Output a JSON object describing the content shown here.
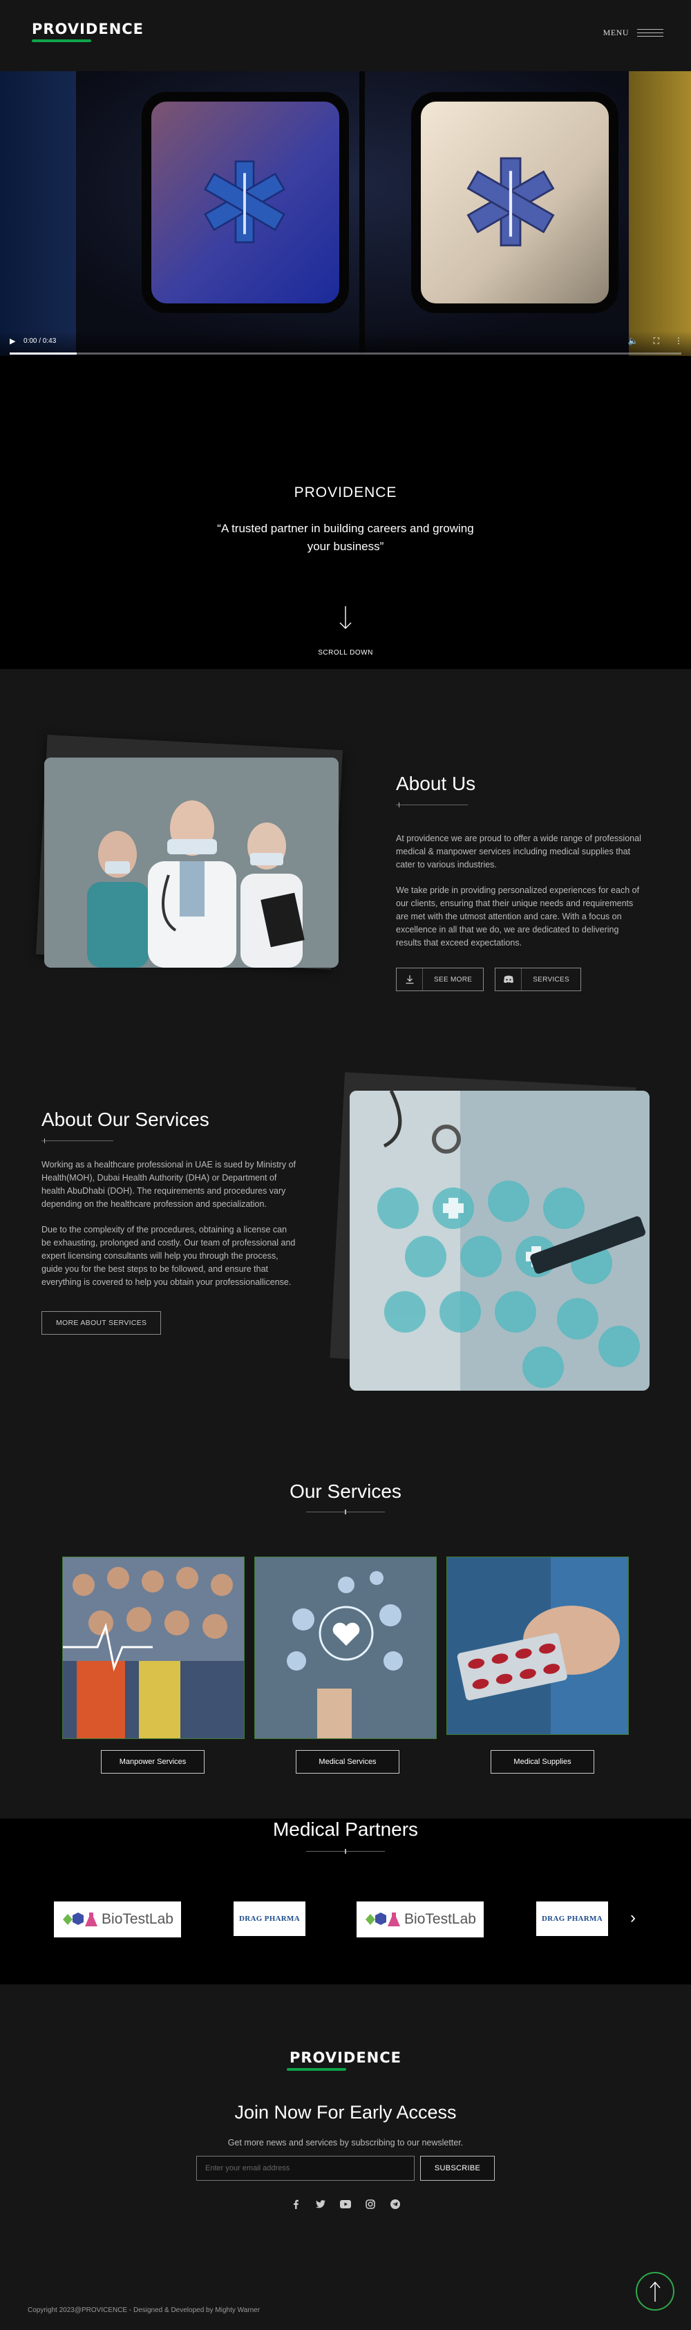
{
  "header": {
    "brand": "PROVIDENCE",
    "menu_label": "MENU",
    "accent_color": "#0fa34a"
  },
  "video": {
    "time": "0:00 / 0:43",
    "progress": 0.1,
    "icons": [
      "play-icon",
      "volume-icon",
      "fullscreen-icon",
      "more-icon"
    ]
  },
  "intro": {
    "title": "PROVIDENCE",
    "quote": "“A trusted partner in building careers and growing your business”",
    "scroll_label": "SCROLL DOWN"
  },
  "about": {
    "title": "About Us",
    "p1": "At providence we are proud to offer a wide range of professional medical & manpower services including medical supplies that cater to various industries.",
    "p2": "We take pride in providing personalized experiences for each of our clients, ensuring that their unique needs and requirements are met with the utmost attention and care. With a focus on excellence in all that we do, we are dedicated to delivering results that exceed expectations.",
    "see_more": "SEE MORE",
    "services": "SERVICES"
  },
  "about_services": {
    "title": "About Our Services",
    "p1": "Working as a healthcare professional in UAE is sued by Ministry of Health(MOH), Dubai Health Authority (DHA) or Department of health AbuDhabi (DOH). The requirements and procedures vary depending on the healthcare profession and specialization.",
    "p2": "Due to the complexity of the procedures, obtaining a license can be exhausting, prolonged and costly. Our team of professional and expert licensing consultants will help you through the process, guide you for the best steps to be followed, and ensure that everything is covered to help you obtain your professionallicense.",
    "button": "MORE ABOUT SERVICES"
  },
  "our_services": {
    "title": "Our Services",
    "cards": [
      {
        "label": "Manpower Services"
      },
      {
        "label": "Medical Services"
      },
      {
        "label": "Medical Supplies"
      }
    ]
  },
  "partners": {
    "title": "Medical Partners",
    "logos": [
      {
        "text": "BioTestLab"
      },
      {
        "text": "DRAG PHARMA"
      },
      {
        "text": "BioTestLab"
      },
      {
        "text": "DRAG PHARMA"
      }
    ]
  },
  "footer": {
    "brand": "PROVIDENCE",
    "join_title": "Join Now For Early Access",
    "join_sub": "Get more news and services by subscribing to our newsletter.",
    "email_placeholder": "Enter your email address",
    "subscribe": "SUBSCRIBE",
    "socials": [
      "facebook-icon",
      "twitter-icon",
      "youtube-icon",
      "instagram-icon",
      "telegram-icon"
    ],
    "copyright": "Copyright 2023@PROVICENCE - Designed & Developed by Mighty Warner"
  }
}
